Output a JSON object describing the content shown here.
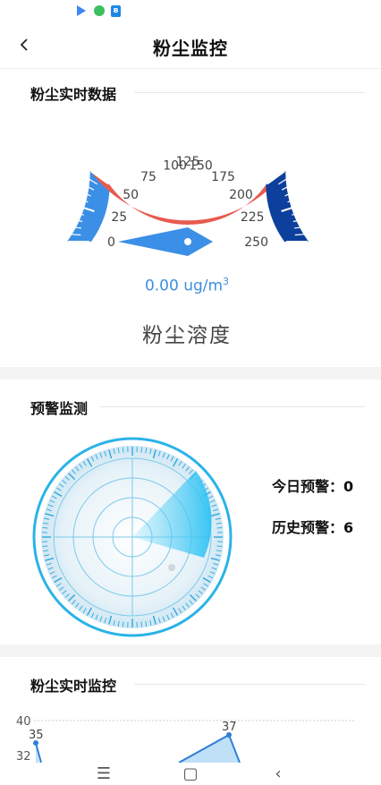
{
  "header": {
    "title": "粉尘监控"
  },
  "realtime_data": {
    "section_title": "粉尘实时数据",
    "gauge": {
      "min": 0,
      "max": 250,
      "ticks": [
        "0",
        "25",
        "50",
        "75",
        "100",
        "125",
        "150",
        "175",
        "200",
        "225",
        "250"
      ],
      "value": 0,
      "value_text": "0.00 ug/m",
      "unit_sup": "3",
      "label": "粉尘溶度",
      "colors": {
        "low": "#3b8fe6",
        "mid": "#e85a4f",
        "high": "#0d3f9c"
      }
    }
  },
  "warning": {
    "section_title": "预警监测",
    "today_label": "今日预警：",
    "today_value": "0",
    "history_label": "历史预警：",
    "history_value": "6"
  },
  "realtime_monitor": {
    "section_title": "粉尘实时监控",
    "chart_data": {
      "type": "area",
      "y_ticks": [
        "40",
        "32"
      ],
      "points": [
        {
          "label": "35",
          "value": 35
        },
        {
          "label": "37",
          "value": 37
        }
      ]
    }
  },
  "nav": {
    "menu_icon": "☰",
    "home_icon": "▢",
    "back_icon": "‹"
  }
}
